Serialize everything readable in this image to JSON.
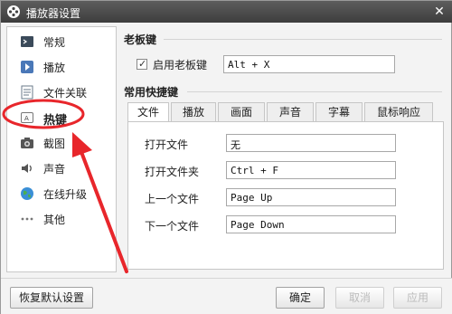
{
  "window": {
    "title": "播放器设置",
    "icons": {
      "app": "film-reel-icon",
      "close": "close-icon"
    }
  },
  "sidebar": {
    "items": [
      {
        "label": "常规",
        "icon": "terminal-icon"
      },
      {
        "label": "播放",
        "icon": "play-icon"
      },
      {
        "label": "文件关联",
        "icon": "document-icon"
      },
      {
        "label": "热键",
        "icon": "keyboard-key-icon",
        "active": true
      },
      {
        "label": "截图",
        "icon": "camera-icon"
      },
      {
        "label": "声音",
        "icon": "speaker-icon"
      },
      {
        "label": "在线升级",
        "icon": "globe-icon"
      },
      {
        "label": "其他",
        "icon": "more-dots-icon"
      }
    ]
  },
  "boss_key": {
    "section_title": "老板键",
    "checkbox_label": "启用老板键",
    "checked": true,
    "value": "Alt + X"
  },
  "shortcuts": {
    "section_title": "常用快捷键",
    "tabs": [
      "文件",
      "播放",
      "画面",
      "声音",
      "字幕",
      "鼠标响应"
    ],
    "active_tab": "文件",
    "rows": [
      {
        "label": "打开文件",
        "value": "无"
      },
      {
        "label": "打开文件夹",
        "value": "Ctrl + F"
      },
      {
        "label": "上一个文件",
        "value": "Page Up"
      },
      {
        "label": "下一个文件",
        "value": "Page Down"
      }
    ]
  },
  "footer": {
    "restore_defaults": "恢复默认设置",
    "ok": "确定",
    "cancel": "取消",
    "apply": "应用"
  },
  "colors": {
    "annotation_red": "#e8262b",
    "titlebar": "#4a4a4a"
  }
}
